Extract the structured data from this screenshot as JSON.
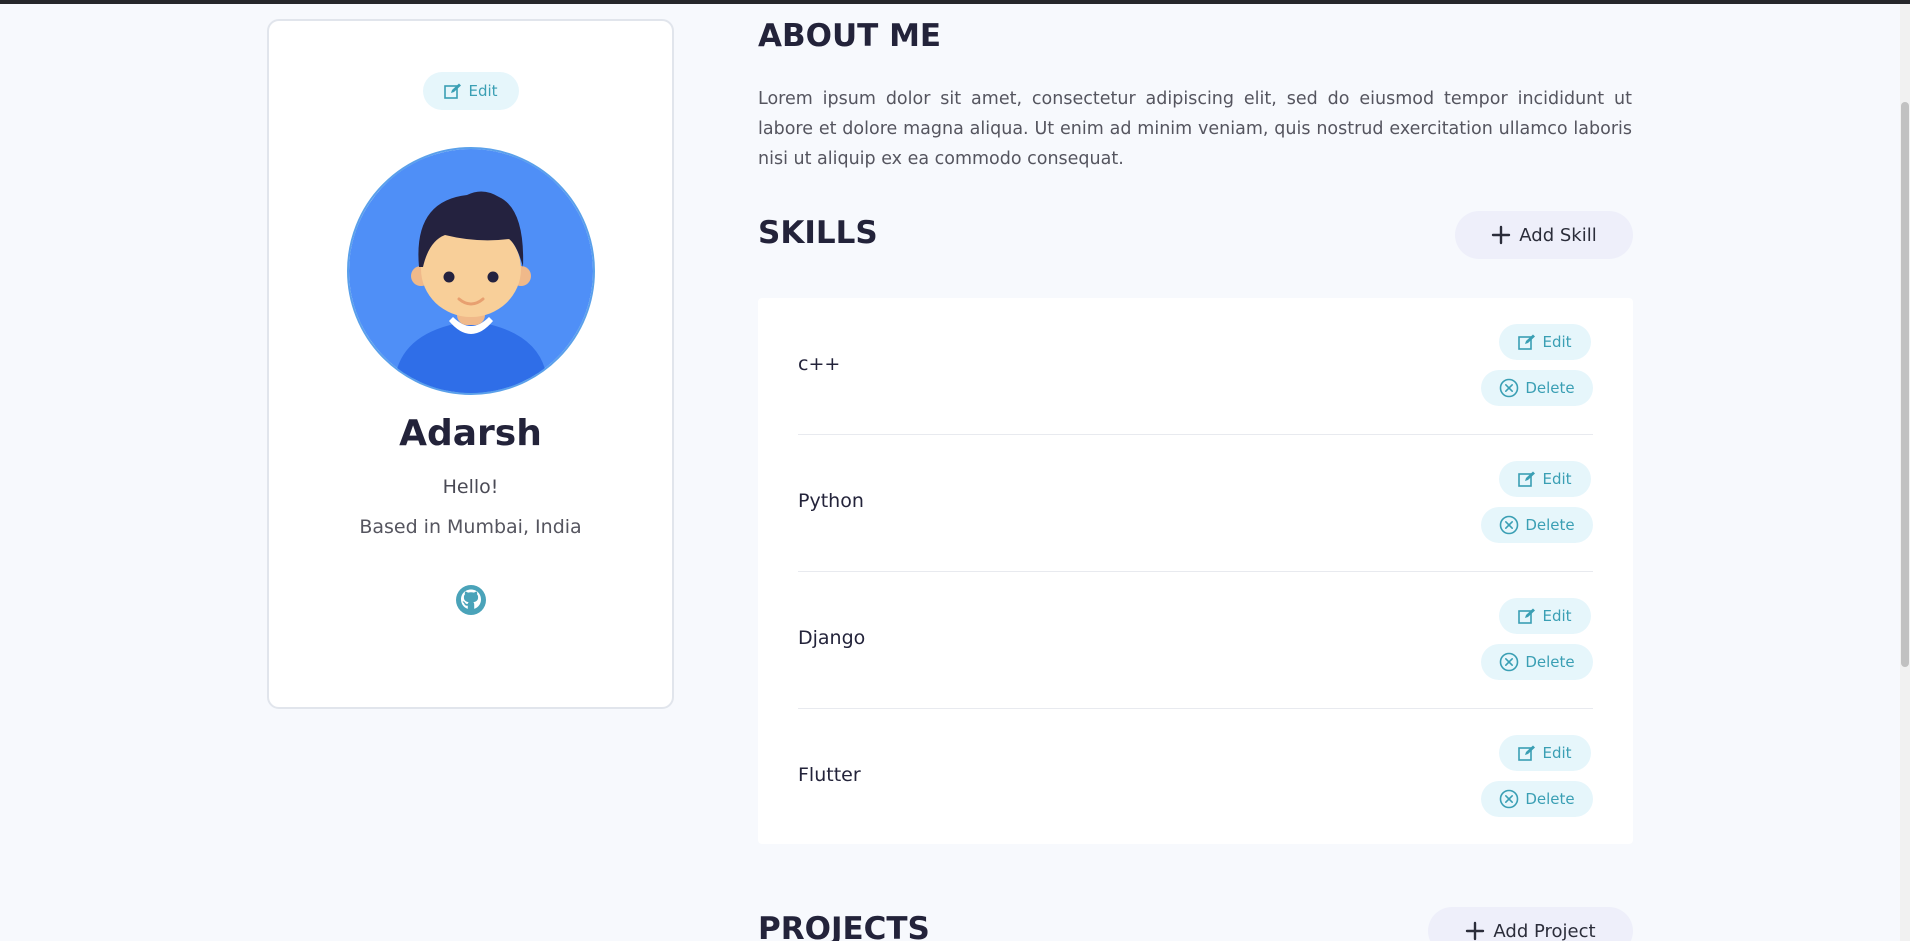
{
  "profile": {
    "edit_label": "Edit",
    "name": "Adarsh",
    "greeting": "Hello!",
    "location": "Based in Mumbai, India",
    "social_icon": "github-icon"
  },
  "about": {
    "title": "ABOUT ME",
    "text": "Lorem ipsum dolor sit amet, consectetur adipiscing elit, sed do eiusmod tempor incididunt ut labore et dolore magna aliqua. Ut enim ad minim veniam, quis nostrud exercitation ullamco laboris nisi ut aliquip ex ea commodo consequat."
  },
  "skills": {
    "title": "SKILLS",
    "add_label": "Add Skill",
    "edit_label": "Edit",
    "delete_label": "Delete",
    "items": [
      {
        "name": "c++"
      },
      {
        "name": "Python"
      },
      {
        "name": "Django"
      },
      {
        "name": "Flutter"
      }
    ]
  },
  "projects": {
    "title": "PROJECTS",
    "add_label": "Add Project"
  },
  "colors": {
    "accent": "#3a9fb4",
    "pill_bg": "#e6f6fb",
    "add_bg": "#eeeffa",
    "avatar_bg": "#4f8ff7",
    "page_bg": "#f7f9fd"
  }
}
